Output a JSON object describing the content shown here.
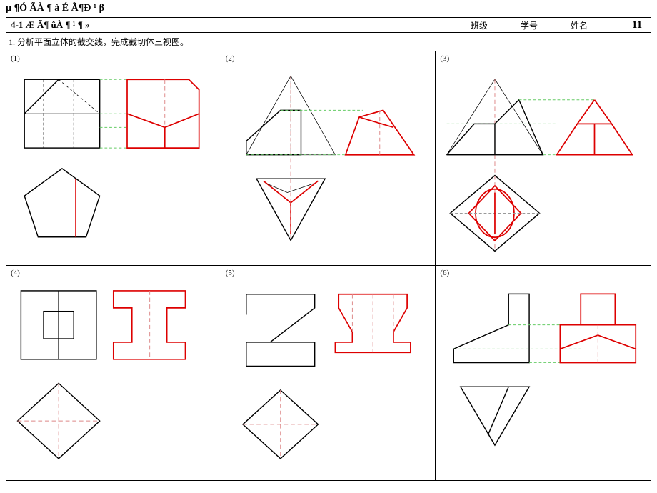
{
  "page_title": "µ ¶Ó ÃÀ ¶ à É Ã¶Ð ¹ β",
  "chapter": "4-1  Æ Ã¶ ûÀ ¶ ¹ ¶ »",
  "header": {
    "class_label": "班级",
    "id_label": "学号",
    "name_label": "姓名",
    "page_num": "11"
  },
  "instruction": "1. 分析平面立体的截交线，完成截切体三视图。",
  "cells": {
    "c1": "(1)",
    "c2": "(2)",
    "c3": "(3)",
    "c4": "(4)",
    "c5": "(5)",
    "c6": "(6)"
  }
}
